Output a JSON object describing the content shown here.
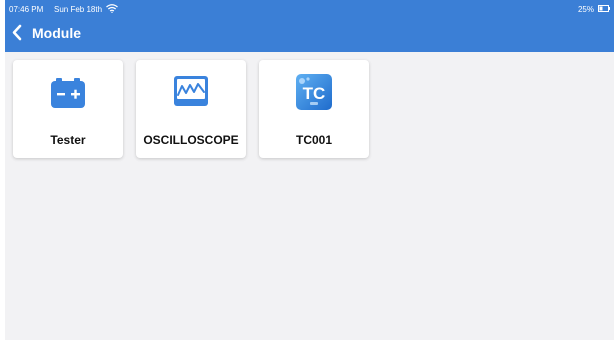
{
  "status_bar": {
    "time": "07:46 PM",
    "date": "Sun Feb 18th",
    "battery": "25%"
  },
  "header": {
    "title": "Module"
  },
  "modules": [
    {
      "label": "Tester",
      "icon": "battery-tester-icon"
    },
    {
      "label": "OSCILLOSCOPE",
      "icon": "oscilloscope-icon"
    },
    {
      "label": "TC001",
      "icon": "tc001-thermal-camera-icon"
    }
  ],
  "colors": {
    "header": "#3b7fd6",
    "background": "#f2f2f4",
    "tile": "#ffffff",
    "icon_blue": "#3a83dd"
  }
}
